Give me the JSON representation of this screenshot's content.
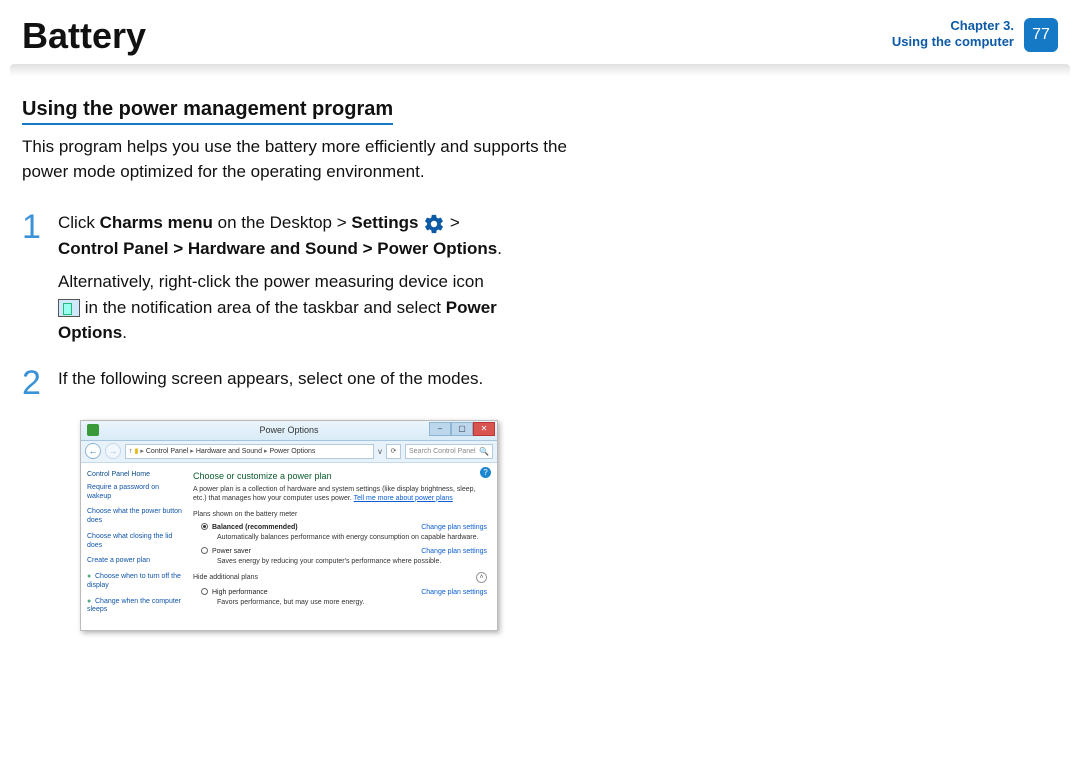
{
  "header": {
    "title": "Battery",
    "chapter_line1": "Chapter 3.",
    "chapter_line2": "Using the computer",
    "page_number": "77"
  },
  "section": {
    "heading": "Using the power management program",
    "intro": "This program helps you use the battery more efficiently and supports the power mode optimized for the operating environment."
  },
  "steps": {
    "s1": {
      "num": "1",
      "t1": "Click ",
      "b1": "Charms menu",
      "t2": " on the Desktop > ",
      "b2": "Settings",
      "t3": " > ",
      "b3": "Control Panel > Hardware and Sound > Power Options",
      "t4": ".",
      "alt1": "Alternatively, right-click the power measuring device icon ",
      "alt2": " in the notification area of the taskbar and select ",
      "b4": "Power Options",
      "t5": "."
    },
    "s2": {
      "num": "2",
      "text": "If the following screen appears, select one of the modes."
    }
  },
  "shot": {
    "title": "Power Options",
    "breadcrumb": {
      "a": "Control Panel",
      "b": "Hardware and Sound",
      "c": "Power Options"
    },
    "search_placeholder": "Search Control Panel",
    "sidebar": {
      "home": "Control Panel Home",
      "l1": "Require a password on wakeup",
      "l2": "Choose what the power button does",
      "l3": "Choose what closing the lid does",
      "l4": "Create a power plan",
      "l5": "Choose when to turn off the display",
      "l6": "Change when the computer sleeps"
    },
    "main": {
      "heading": "Choose or customize a power plan",
      "desc": "A power plan is a collection of hardware and system settings (like display brightness, sleep, etc.) that manages how your computer uses power. ",
      "more": "Tell me more about power plans",
      "meter_label": "Plans shown on the battery meter",
      "plan1_name": "Balanced (recommended)",
      "plan1_desc": "Automatically balances performance with energy consumption on capable hardware.",
      "plan2_name": "Power saver",
      "plan2_desc": "Saves energy by reducing your computer's performance where possible.",
      "hide_label": "Hide additional plans",
      "plan3_name": "High performance",
      "plan3_desc": "Favors performance, but may use more energy.",
      "change": "Change plan settings"
    }
  }
}
